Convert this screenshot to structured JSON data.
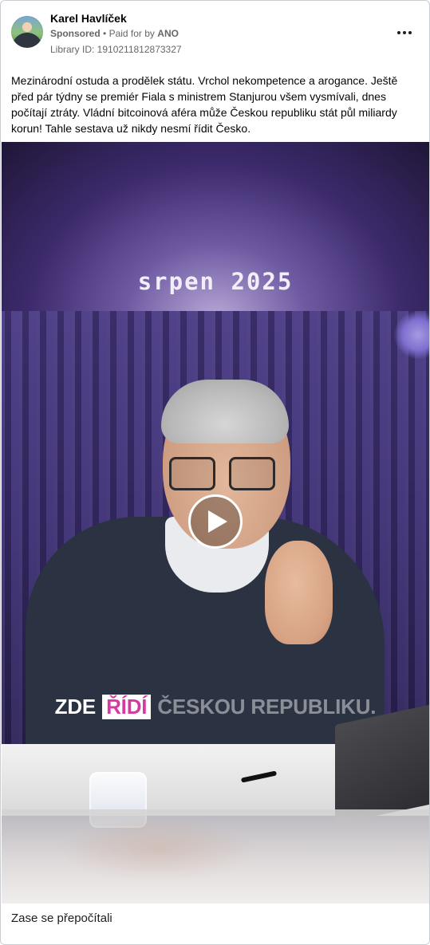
{
  "ad": {
    "advertiser_name": "Karel Havlíček",
    "sponsored_label": "Sponsored",
    "separator": "•",
    "paid_for_by_prefix": "Paid for by",
    "paid_for_by": "ANO",
    "library_id_label": "Library ID: 1910211812873327",
    "more_options_icon": "more-horizontal-icon",
    "body_text": "Mezinárodní ostuda a prodělek státu. Vrchol nekompetence a arogance. Ještě před pár týdny se premiér Fiala s ministrem Stanjurou všem vysmívali, dnes počítají ztráty. Vládní bitcoinová aféra může Českou republiku stát půl miliardy korun! Tahle sestava už nikdy nesmí řídit Česko.",
    "video": {
      "overlay_date_text": "srpen 2025",
      "caption": {
        "part1": "ZDE",
        "highlight": "ŘÍDÍ",
        "part2": "ČESKOU REPUBLIKU."
      },
      "play_icon": "play-icon"
    },
    "footer_title": "Zase se přepočítali"
  },
  "colors": {
    "text_primary": "#050505",
    "text_secondary": "#65676b",
    "border": "#c9ccd1",
    "caption_highlight": "#d63aa2"
  }
}
